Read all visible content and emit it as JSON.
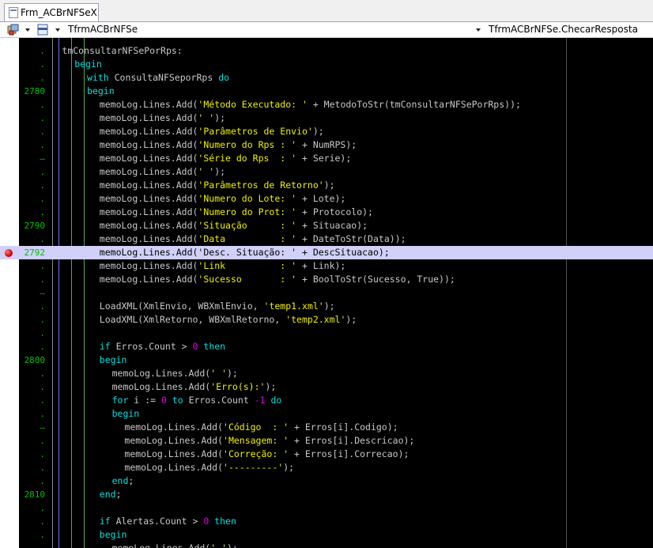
{
  "tab": {
    "label": "Frm_ACBrNFSeX"
  },
  "toolbar": {
    "class_selector": "TfrmACBrNFSe",
    "method_selector": "TfrmACBrNFSe.ChecarResposta"
  },
  "breakpoint_color": "#d00000",
  "colors": {
    "keyword": "#00e0e0",
    "string": "#f0f000",
    "number": "#e000e0",
    "plain": "#c8c8c8",
    "line_number": "#00c000",
    "highlight": "#d0d0f8"
  },
  "lines": [
    {
      "num": ".",
      "indent": 3,
      "tokens": [
        [
          "p",
          "tmConsultarNFSePorRps:"
        ]
      ]
    },
    {
      "num": ".",
      "indent": 4,
      "tokens": [
        [
          "k",
          "begin"
        ]
      ]
    },
    {
      "num": ".",
      "indent": 5,
      "tokens": [
        [
          "k",
          "with"
        ],
        [
          "p",
          " ConsultaNFSeporRps "
        ],
        [
          "k",
          "do"
        ]
      ]
    },
    {
      "num": "2780",
      "indent": 5,
      "tokens": [
        [
          "k",
          "begin"
        ]
      ]
    },
    {
      "num": ".",
      "indent": 6,
      "tokens": [
        [
          "p",
          "memoLog.Lines.Add("
        ],
        [
          "s",
          "'Método Executado: '"
        ],
        [
          "p",
          " + MetodoToStr(tmConsultarNFSePorRps));"
        ]
      ]
    },
    {
      "num": ".",
      "indent": 6,
      "tokens": [
        [
          "p",
          "memoLog.Lines.Add("
        ],
        [
          "s",
          "' '"
        ],
        [
          "p",
          ");"
        ]
      ]
    },
    {
      "num": ".",
      "indent": 6,
      "tokens": [
        [
          "p",
          "memoLog.Lines.Add("
        ],
        [
          "s",
          "'Parâmetros de Envio'"
        ],
        [
          "p",
          ");"
        ]
      ]
    },
    {
      "num": ".",
      "indent": 6,
      "tokens": [
        [
          "p",
          "memoLog.Lines.Add("
        ],
        [
          "s",
          "'Numero do Rps : '"
        ],
        [
          "p",
          " + NumRPS);"
        ]
      ]
    },
    {
      "num": "–",
      "indent": 6,
      "tokens": [
        [
          "p",
          "memoLog.Lines.Add("
        ],
        [
          "s",
          "'Série do Rps  : '"
        ],
        [
          "p",
          " + Serie);"
        ]
      ]
    },
    {
      "num": ".",
      "indent": 6,
      "tokens": [
        [
          "p",
          "memoLog.Lines.Add("
        ],
        [
          "s",
          "' '"
        ],
        [
          "p",
          ");"
        ]
      ]
    },
    {
      "num": ".",
      "indent": 6,
      "tokens": [
        [
          "p",
          "memoLog.Lines.Add("
        ],
        [
          "s",
          "'Parâmetros de Retorno'"
        ],
        [
          "p",
          ");"
        ]
      ]
    },
    {
      "num": ".",
      "indent": 6,
      "tokens": [
        [
          "p",
          "memoLog.Lines.Add("
        ],
        [
          "s",
          "'Numero do Lote: '"
        ],
        [
          "p",
          " + Lote);"
        ]
      ]
    },
    {
      "num": ".",
      "indent": 6,
      "tokens": [
        [
          "p",
          "memoLog.Lines.Add("
        ],
        [
          "s",
          "'Numero do Prot: '"
        ],
        [
          "p",
          " + Protocolo);"
        ]
      ]
    },
    {
      "num": "2790",
      "indent": 6,
      "tokens": [
        [
          "p",
          "memoLog.Lines.Add("
        ],
        [
          "s",
          "'Situação      : '"
        ],
        [
          "p",
          " + Situacao);"
        ]
      ]
    },
    {
      "num": ".",
      "indent": 6,
      "tokens": [
        [
          "p",
          "memoLog.Lines.Add("
        ],
        [
          "s",
          "'Data          : '"
        ],
        [
          "p",
          " + DateToStr(Data));"
        ]
      ]
    },
    {
      "num": "2792",
      "indent": 6,
      "highlight": true,
      "breakpoint": true,
      "tokens": [
        [
          "p",
          "memoLog.Lines.Add("
        ],
        [
          "p",
          "'Desc. Situação: '"
        ],
        [
          "p",
          " + DescSituacao);"
        ]
      ]
    },
    {
      "num": ".",
      "indent": 6,
      "tokens": [
        [
          "p",
          "memoLog.Lines.Add("
        ],
        [
          "s",
          "'Link          : '"
        ],
        [
          "p",
          " + Link);"
        ]
      ]
    },
    {
      "num": ".",
      "indent": 6,
      "tokens": [
        [
          "p",
          "memoLog.Lines.Add("
        ],
        [
          "s",
          "'Sucesso       : '"
        ],
        [
          "p",
          " + BoolToStr(Sucesso, True));"
        ]
      ]
    },
    {
      "num": "–",
      "indent": 6,
      "tokens": []
    },
    {
      "num": ".",
      "indent": 6,
      "tokens": [
        [
          "p",
          "LoadXML(XmlEnvio, WBXmlEnvio, "
        ],
        [
          "s",
          "'temp1.xml'"
        ],
        [
          "p",
          ");"
        ]
      ]
    },
    {
      "num": ".",
      "indent": 6,
      "tokens": [
        [
          "p",
          "LoadXML(XmlRetorno, WBXmlRetorno, "
        ],
        [
          "s",
          "'temp2.xml'"
        ],
        [
          "p",
          ");"
        ]
      ]
    },
    {
      "num": ".",
      "indent": 6,
      "tokens": []
    },
    {
      "num": ".",
      "indent": 6,
      "tokens": [
        [
          "k",
          "if"
        ],
        [
          "p",
          " Erros.Count > "
        ],
        [
          "n",
          "0"
        ],
        [
          "p",
          " "
        ],
        [
          "k",
          "then"
        ]
      ]
    },
    {
      "num": "2800",
      "indent": 6,
      "tokens": [
        [
          "k",
          "begin"
        ]
      ]
    },
    {
      "num": ".",
      "indent": 7,
      "tokens": [
        [
          "p",
          "memoLog.Lines.Add("
        ],
        [
          "s",
          "' '"
        ],
        [
          "p",
          ");"
        ]
      ]
    },
    {
      "num": ".",
      "indent": 7,
      "tokens": [
        [
          "p",
          "memoLog.Lines.Add("
        ],
        [
          "s",
          "'Erro(s):'"
        ],
        [
          "p",
          ");"
        ]
      ]
    },
    {
      "num": ".",
      "indent": 7,
      "tokens": [
        [
          "k",
          "for"
        ],
        [
          "p",
          " i := "
        ],
        [
          "n",
          "0"
        ],
        [
          "p",
          " "
        ],
        [
          "k",
          "to"
        ],
        [
          "p",
          " Erros.Count "
        ],
        [
          "n",
          "-1"
        ],
        [
          "p",
          " "
        ],
        [
          "k",
          "do"
        ]
      ]
    },
    {
      "num": ".",
      "indent": 7,
      "tokens": [
        [
          "k",
          "begin"
        ]
      ]
    },
    {
      "num": "–",
      "indent": 8,
      "tokens": [
        [
          "p",
          "memoLog.Lines.Add("
        ],
        [
          "s",
          "'Código  : '"
        ],
        [
          "p",
          " + Erros[i].Codigo);"
        ]
      ]
    },
    {
      "num": ".",
      "indent": 8,
      "tokens": [
        [
          "p",
          "memoLog.Lines.Add("
        ],
        [
          "s",
          "'Mensagem: '"
        ],
        [
          "p",
          " + Erros[i].Descricao);"
        ]
      ]
    },
    {
      "num": ".",
      "indent": 8,
      "tokens": [
        [
          "p",
          "memoLog.Lines.Add("
        ],
        [
          "s",
          "'Correção: '"
        ],
        [
          "p",
          " + Erros[i].Correcao);"
        ]
      ]
    },
    {
      "num": ".",
      "indent": 8,
      "tokens": [
        [
          "p",
          "memoLog.Lines.Add("
        ],
        [
          "s",
          "'---------'"
        ],
        [
          "p",
          ");"
        ]
      ]
    },
    {
      "num": ".",
      "indent": 7,
      "tokens": [
        [
          "k",
          "end"
        ],
        [
          "p",
          ";"
        ]
      ]
    },
    {
      "num": "2810",
      "indent": 6,
      "tokens": [
        [
          "k",
          "end"
        ],
        [
          "p",
          ";"
        ]
      ]
    },
    {
      "num": ".",
      "indent": 6,
      "tokens": []
    },
    {
      "num": ".",
      "indent": 6,
      "tokens": [
        [
          "k",
          "if"
        ],
        [
          "p",
          " Alertas.Count > "
        ],
        [
          "n",
          "0"
        ],
        [
          "p",
          " "
        ],
        [
          "k",
          "then"
        ]
      ]
    },
    {
      "num": ".",
      "indent": 6,
      "tokens": [
        [
          "k",
          "begin"
        ]
      ]
    },
    {
      "num": ".",
      "indent": 7,
      "tokens": [
        [
          "p",
          "memoLog.Lines.Add("
        ],
        [
          "s",
          "' '"
        ],
        [
          "p",
          ");"
        ]
      ]
    }
  ]
}
